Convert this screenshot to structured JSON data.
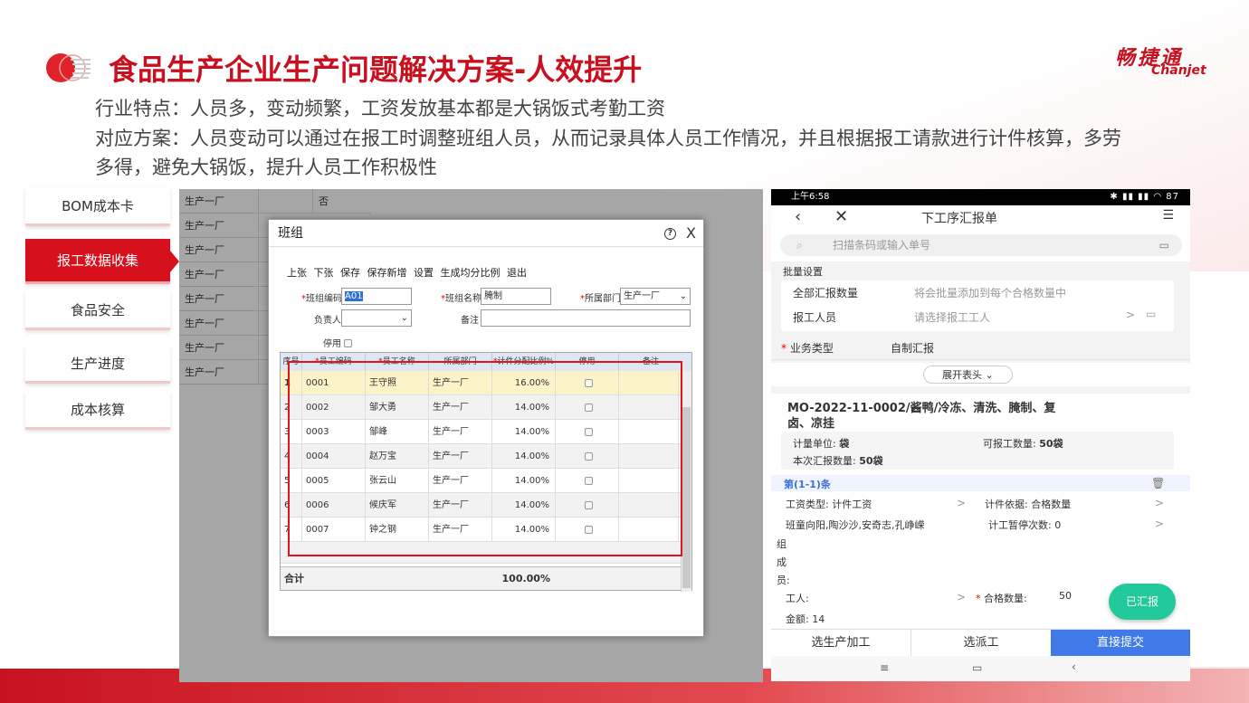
{
  "header": {
    "title": "食品生产企业生产问题解决方案-人效提升",
    "brand_cn": "畅捷通",
    "brand_en": "Chanjet"
  },
  "intro": {
    "line1": "行业特点：人员多，变动频繁，工资发放基本都是大锅饭式考勤工资",
    "line2": "对应方案：人员变动可以通过在报工时调整班组人员，从而记录具体人员工作情况，并且根据报工请款进行计件核算，多劳",
    "line3": "多得，避免大锅饭，提升人员工作积极性"
  },
  "sidebar": {
    "items": [
      {
        "label": "BOM成本卡"
      },
      {
        "label": "报工数据收集"
      },
      {
        "label": "食品安全"
      },
      {
        "label": "生产进度"
      },
      {
        "label": "成本核算"
      }
    ]
  },
  "background_table": {
    "col1": [
      "生产一厂",
      "生产一厂",
      "生产一厂",
      "生产一厂",
      "生产一厂",
      "生产一厂",
      "生产一厂",
      "生产一厂"
    ],
    "first_row_flag": "否"
  },
  "dialog": {
    "title": "班组",
    "help_icon": "?",
    "close_icon": "X",
    "toolbar": [
      "上张",
      "下张",
      "保存",
      "保存新增",
      "设置",
      "生成均分比例",
      "退出"
    ],
    "form": {
      "code_label": "班组编码",
      "code_value": "A01",
      "name_label": "班组名称",
      "name_value": "腌制",
      "dept_label": "所属部门",
      "dept_value": "生产一厂",
      "leader_label": "负责人",
      "leader_value": "",
      "note_label": "备注",
      "note_value": "",
      "disabled_label": "停用"
    },
    "grid": {
      "headers": [
        "序号",
        "员工编码",
        "员工名称",
        "所属部门",
        "计件分配比例%",
        "停用",
        "备注"
      ],
      "rows": [
        {
          "seq": "1",
          "code": "0001",
          "name": "王守照",
          "dept": "生产一厂",
          "ratio": "16.00%"
        },
        {
          "seq": "2",
          "code": "0002",
          "name": "邹大勇",
          "dept": "生产一厂",
          "ratio": "14.00%"
        },
        {
          "seq": "3",
          "code": "0003",
          "name": "邹峰",
          "dept": "生产一厂",
          "ratio": "14.00%"
        },
        {
          "seq": "4",
          "code": "0004",
          "name": "赵万宝",
          "dept": "生产一厂",
          "ratio": "14.00%"
        },
        {
          "seq": "5",
          "code": "0005",
          "name": "张云山",
          "dept": "生产一厂",
          "ratio": "14.00%"
        },
        {
          "seq": "6",
          "code": "0006",
          "name": "候庆军",
          "dept": "生产一厂",
          "ratio": "14.00%"
        },
        {
          "seq": "7",
          "code": "0007",
          "name": "钟之钢",
          "dept": "生产一厂",
          "ratio": "14.00%"
        }
      ],
      "total_label": "合计",
      "total_value": "100.00%"
    }
  },
  "phone": {
    "status_time": "上午6:58",
    "status_right": "87",
    "nav_title": "下工序汇报单",
    "search_placeholder": "扫描条码或输入单号",
    "batch_title": "批量设置",
    "batch_qty_label": "全部汇报数量",
    "batch_qty_hint": "将会批量添加到每个合格数量中",
    "worker_label": "报工人员",
    "worker_hint": "请选择报工工人",
    "biz_type_label": "业务类型",
    "biz_type_value": "自制汇报",
    "expand_label": "展开表头",
    "mo_title_1": "MO-2022-11-0002/酱鸭/冷冻、清洗、腌制、复",
    "mo_title_2": "卤、凉挂",
    "unit_label": "计量单位:",
    "unit_value": "袋",
    "avail_label": "可报工数量:",
    "avail_value": "50袋",
    "this_label": "本次汇报数量:",
    "this_value": "50袋",
    "entry_label": "第(1-1)条",
    "wage_type_label": "工资类型: 计件工资",
    "wage_basis_label": "计件依据: 合格数量",
    "team_label": "班童向阳,陶沙沙,安奇志,孔峥嵘",
    "pause_label": "计工暂停次数: 0",
    "team_side": [
      "组",
      "成",
      "员:"
    ],
    "worker2_label": "工人:",
    "qualified_label": "合格数量:",
    "qualified_value": "50",
    "amount_label": "金额:",
    "amount_value": "14",
    "fab_label": "已汇报",
    "btn_process": "选生产加工",
    "btn_dispatch": "选派工",
    "btn_submit": "直接提交"
  },
  "colors": {
    "brand_red": "#c8101f",
    "submit_blue": "#3f7ae8",
    "fab_green": "#22c99a"
  }
}
